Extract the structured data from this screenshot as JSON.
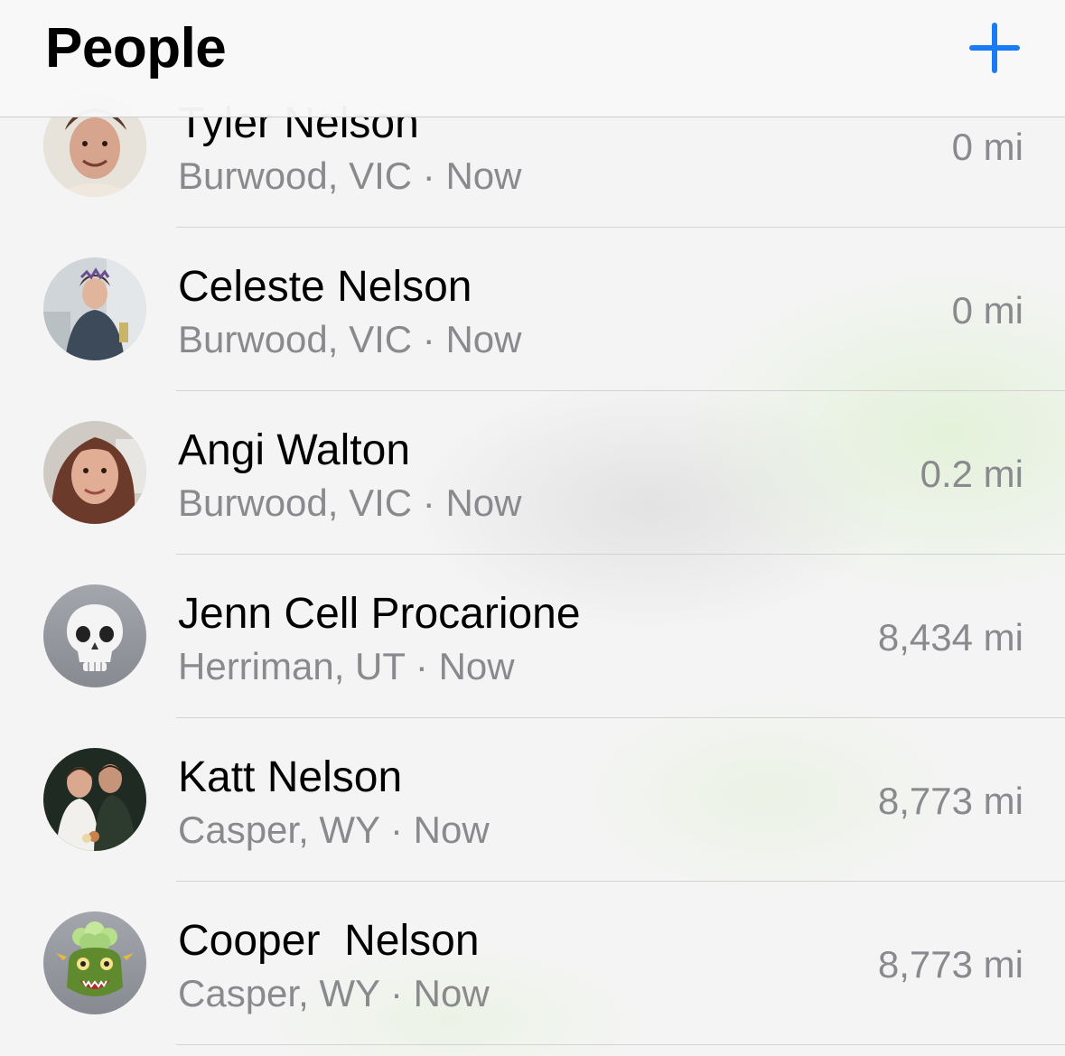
{
  "header": {
    "title": "People",
    "add_icon": "plus-icon",
    "accent_color": "#1a7cf4"
  },
  "people": [
    {
      "name": "Tyler Nelson",
      "location": "Burwood, VIC",
      "time": "Now",
      "distance": "0 mi",
      "avatar": "photo"
    },
    {
      "name": "Celeste Nelson",
      "location": "Burwood, VIC",
      "time": "Now",
      "distance": "0 mi",
      "avatar": "photo"
    },
    {
      "name": "Angi Walton",
      "location": "Burwood, VIC",
      "time": "Now",
      "distance": "0.2 mi",
      "avatar": "photo"
    },
    {
      "name": "Jenn Cell Procarione",
      "location": "Herriman, UT",
      "time": "Now",
      "distance": "8,434 mi",
      "avatar": "skull-memoji-icon"
    },
    {
      "name": "Katt Nelson",
      "location": "Casper, WY",
      "time": "Now",
      "distance": "8,773 mi",
      "avatar": "photo"
    },
    {
      "name": "Cooper  Nelson",
      "location": "Casper, WY",
      "time": "Now",
      "distance": "8,773 mi",
      "avatar": "dragon-memoji-icon"
    }
  ]
}
